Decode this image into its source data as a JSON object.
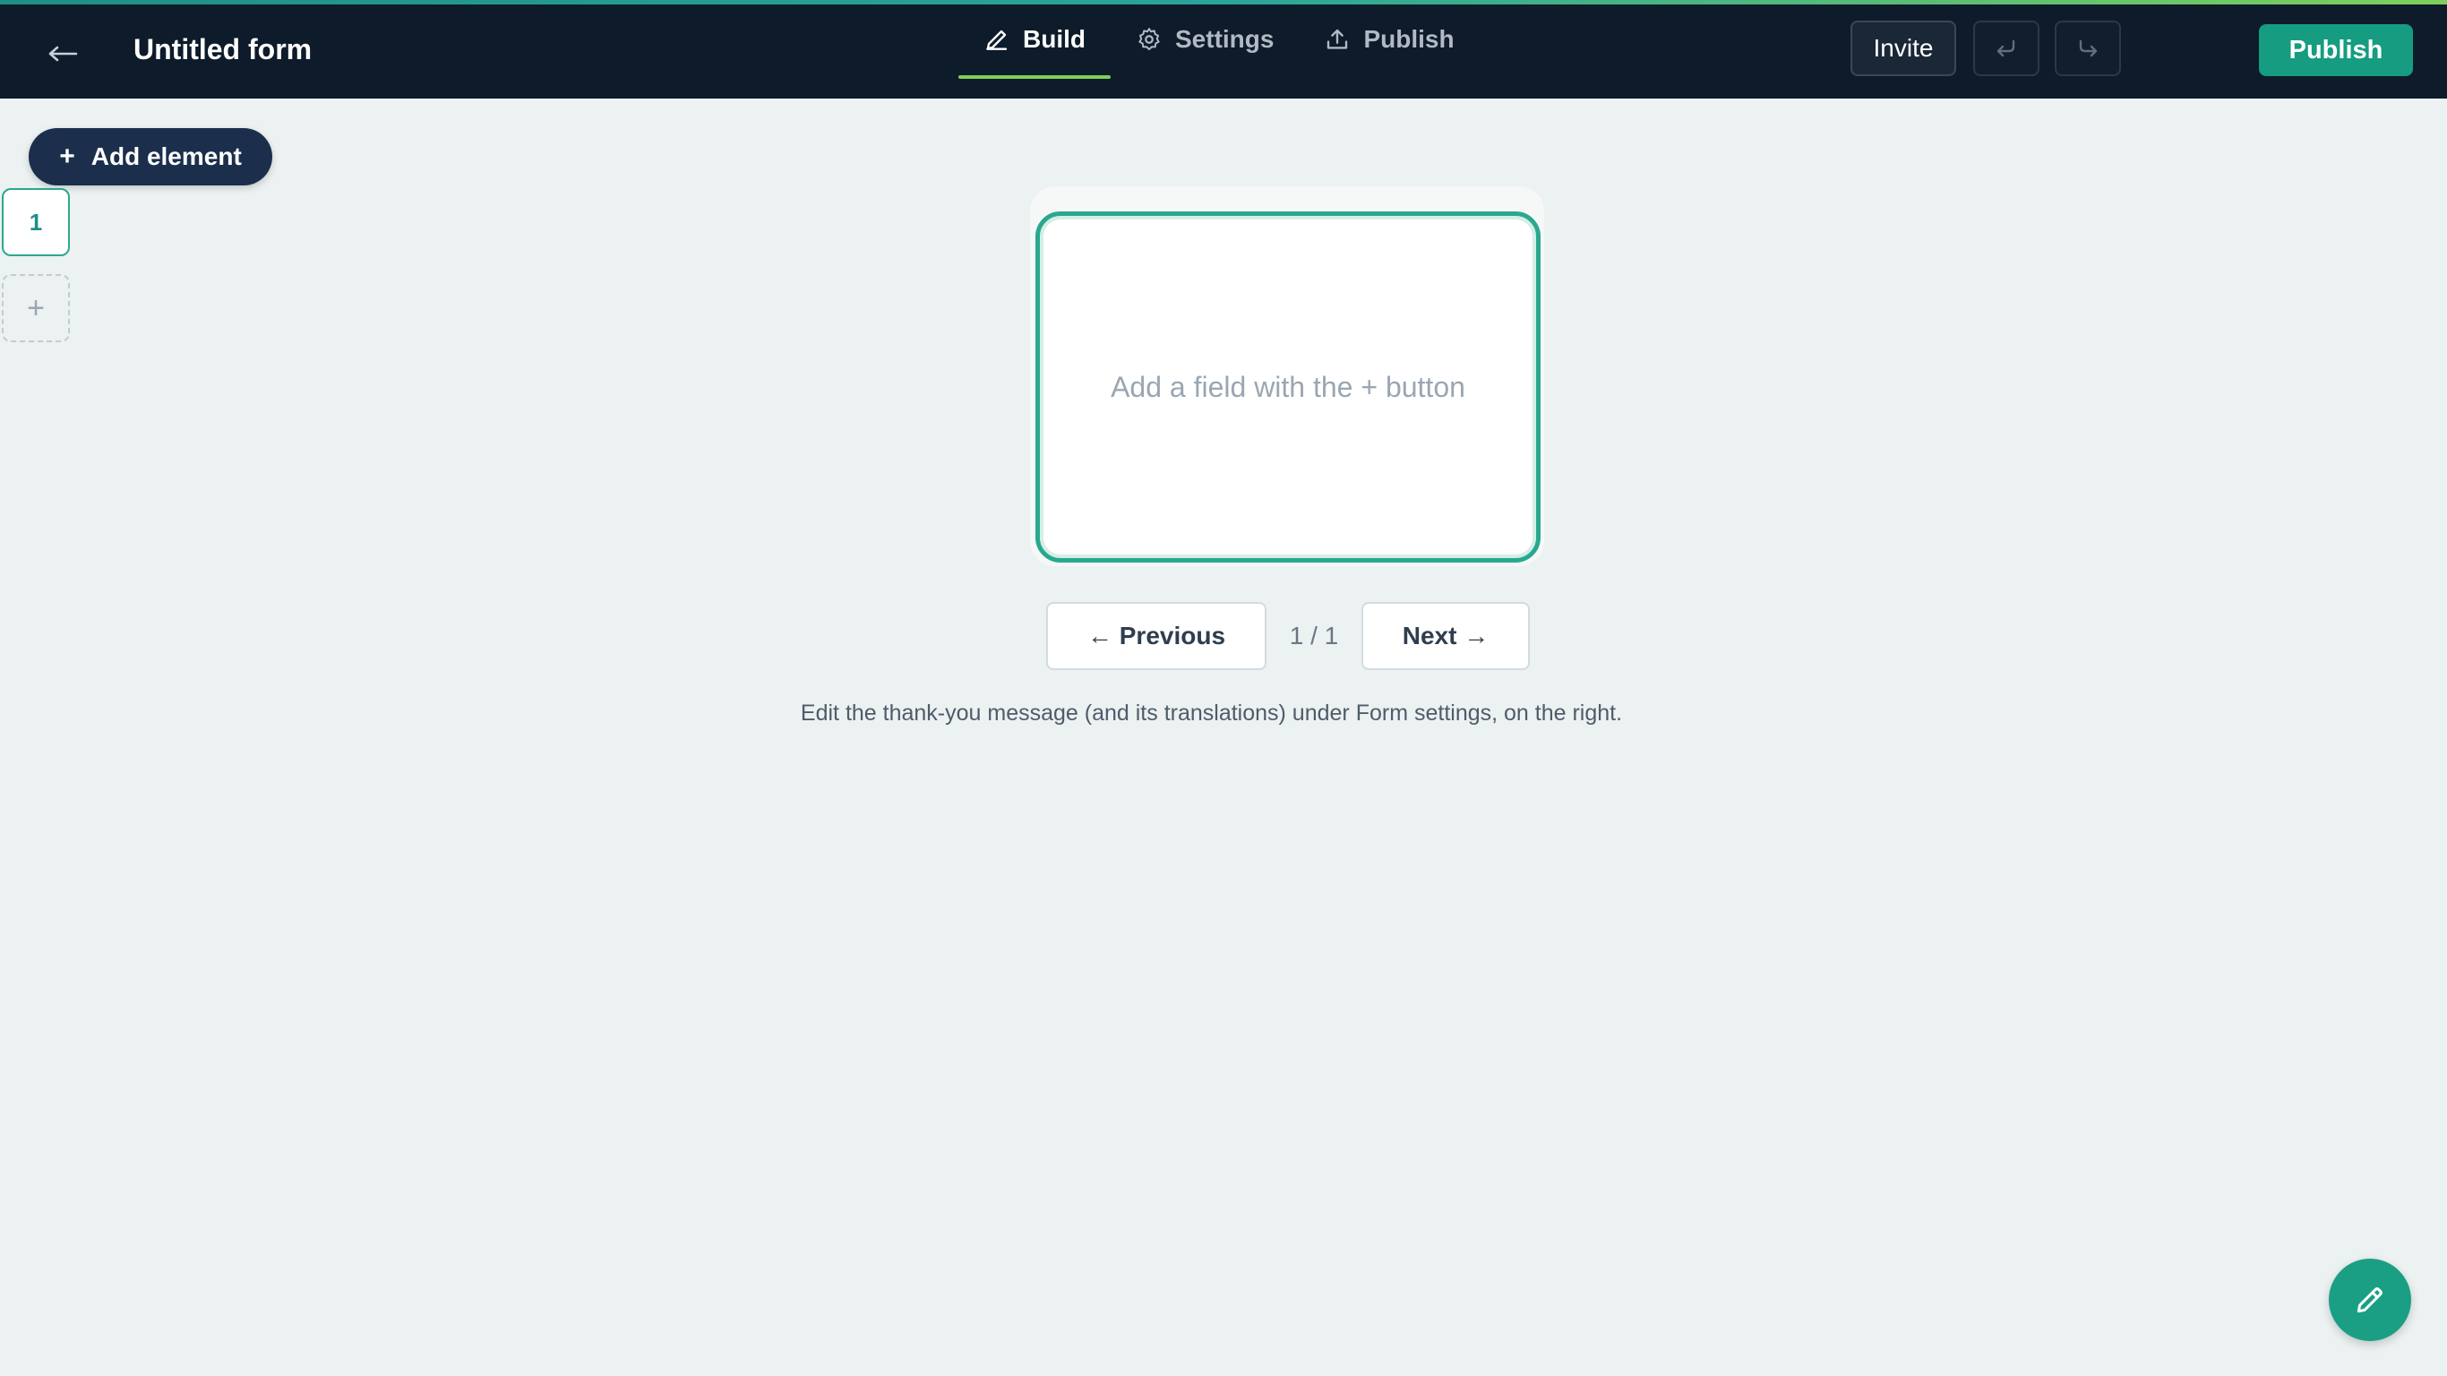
{
  "header": {
    "title": "Untitled form",
    "back_icon": "arrow-left-icon",
    "tabs": [
      {
        "label": "Build",
        "icon": "pencil-icon",
        "active": true
      },
      {
        "label": "Settings",
        "icon": "gear-icon",
        "active": false
      },
      {
        "label": "Publish",
        "icon": "upload-icon",
        "active": false
      }
    ],
    "invite_label": "Invite",
    "undo_icon": "undo-icon",
    "redo_icon": "redo-icon",
    "publish_label": "Publish"
  },
  "sidebar": {
    "add_element_label": "Add element",
    "pages": [
      "1"
    ],
    "add_page_label": "+"
  },
  "canvas": {
    "placeholder": "Add a field with the + button",
    "previous_label": "← Previous",
    "next_label": "Next →",
    "page_counter": "1 / 1",
    "hint": "Edit the thank-you message (and its translations) under Form settings, on the right."
  },
  "fab": {
    "icon": "pencil-icon"
  },
  "colors": {
    "topbar": "#0d1b2a",
    "accent_green": "#169c80",
    "card_border": "#2aa88f",
    "tab_underline": "#7fcf5a",
    "background": "#ecf1f1",
    "add_button": "#1b2f4d"
  }
}
